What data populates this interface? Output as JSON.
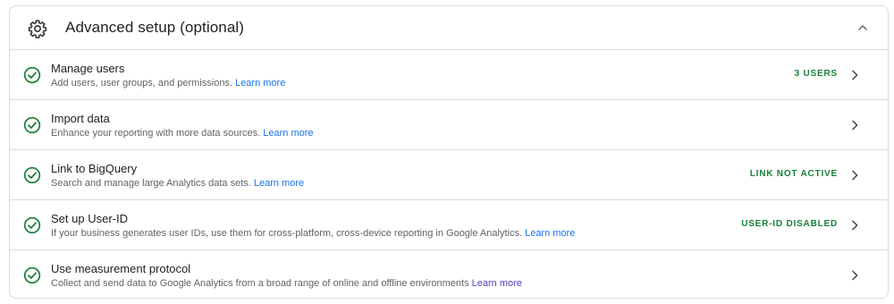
{
  "section": {
    "title": "Advanced setup (optional)",
    "header_icon": "gear-icon",
    "collapse_icon": "chevron-up-icon"
  },
  "colors": {
    "check": "#188038",
    "link": "#1a73e8",
    "link_visited": "#5b3cc4",
    "status": "#188038"
  },
  "rows": [
    {
      "title": "Manage users",
      "description": "Add users, user groups, and permissions.",
      "link": "Learn more",
      "status": "3 USERS"
    },
    {
      "title": "Import data",
      "description": "Enhance your reporting with more data sources.",
      "link": "Learn more",
      "status": ""
    },
    {
      "title": "Link to BigQuery",
      "description": "Search and manage large Analytics data sets.",
      "link": "Learn more",
      "status": "LINK NOT ACTIVE"
    },
    {
      "title": "Set up User-ID",
      "description": "If your business generates user IDs, use them for cross-platform, cross-device reporting in Google Analytics.",
      "link": "Learn more",
      "status": "USER-ID DISABLED"
    },
    {
      "title": "Use measurement protocol",
      "description": "Collect and send data to Google Analytics from a broad range of online and offline environments",
      "link": "Learn more",
      "status": ""
    }
  ]
}
